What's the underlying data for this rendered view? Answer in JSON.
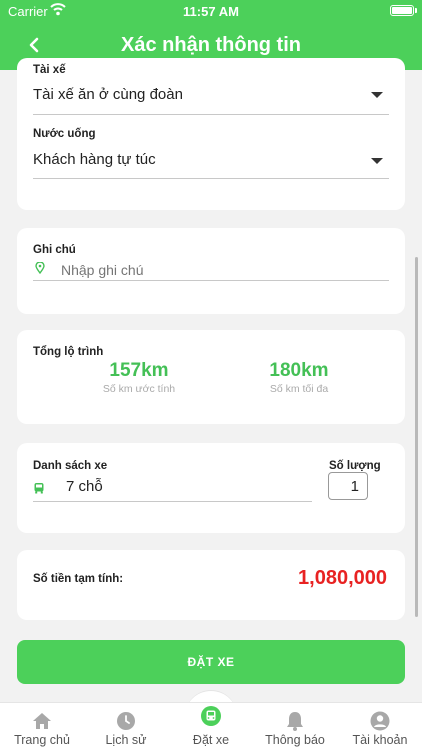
{
  "status": {
    "carrier": "Carrier",
    "time": "11:57 AM"
  },
  "header": {
    "title": "Xác nhận thông tin"
  },
  "form": {
    "driver": {
      "label": "Tài xế",
      "value": "Tài xế ăn ở cùng đoàn"
    },
    "water": {
      "label": "Nước uống",
      "value": "Khách hàng tự túc"
    }
  },
  "note": {
    "label": "Ghi chú",
    "placeholder": "Nhập ghi chú"
  },
  "route": {
    "label": "Tổng lộ trình",
    "estimated": {
      "value": "157km",
      "caption": "Số km ước tính"
    },
    "maximum": {
      "value": "180km",
      "caption": "Số km tối đa"
    }
  },
  "vehicles": {
    "label": "Danh sách xe",
    "value": "7 chỗ",
    "qty_label": "Số lượng",
    "qty": "1"
  },
  "price": {
    "label": "Số tiền tạm tính:",
    "value": "1,080,000"
  },
  "book_button": "ĐẶT XE",
  "tabs": [
    {
      "label": "Trang chủ",
      "icon": "home-icon"
    },
    {
      "label": "Lịch sử",
      "icon": "clock-icon"
    },
    {
      "label": "Đặt xe",
      "icon": "bus-icon"
    },
    {
      "label": "Thông báo",
      "icon": "bell-icon"
    },
    {
      "label": "Tài khoản",
      "icon": "user-icon"
    }
  ],
  "colors": {
    "primary": "#4cd05a",
    "price": "#e82222",
    "distance": "#44c056"
  }
}
